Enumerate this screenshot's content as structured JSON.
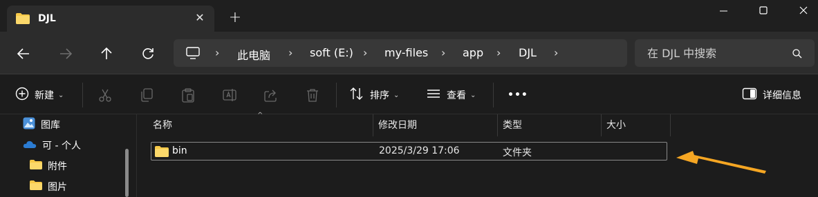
{
  "window": {
    "tab_title": "DJL",
    "tab_close": "✕",
    "new_tab": "+"
  },
  "nav": {
    "breadcrumb": [
      "此电脑",
      "soft (E:)",
      "my-files",
      "app",
      "DJL"
    ],
    "separator": "›"
  },
  "search": {
    "placeholder": "在 DJL 中搜索"
  },
  "toolbar": {
    "new_label": "新建",
    "sort_label": "排序",
    "view_label": "查看",
    "more_label": "•••",
    "details_label": "详细信息",
    "caret": "⌄"
  },
  "sidebar": {
    "items": [
      {
        "label": "图库",
        "icon": "gallery-icon"
      },
      {
        "label": "可 - 个人",
        "icon": "onedrive-icon"
      },
      {
        "label": "附件",
        "icon": "folder-icon"
      },
      {
        "label": "图片",
        "icon": "folder-icon"
      }
    ]
  },
  "filelist": {
    "columns": [
      "名称",
      "修改日期",
      "类型",
      "大小"
    ],
    "sort_indicator": "^",
    "rows": [
      {
        "name": "bin",
        "modified": "2025/3/29 17:06",
        "type": "文件夹",
        "size": ""
      }
    ]
  },
  "colors": {
    "folder": "#f7c948",
    "annotation_arrow": "#f5a623",
    "background": "#1c1c1c"
  }
}
